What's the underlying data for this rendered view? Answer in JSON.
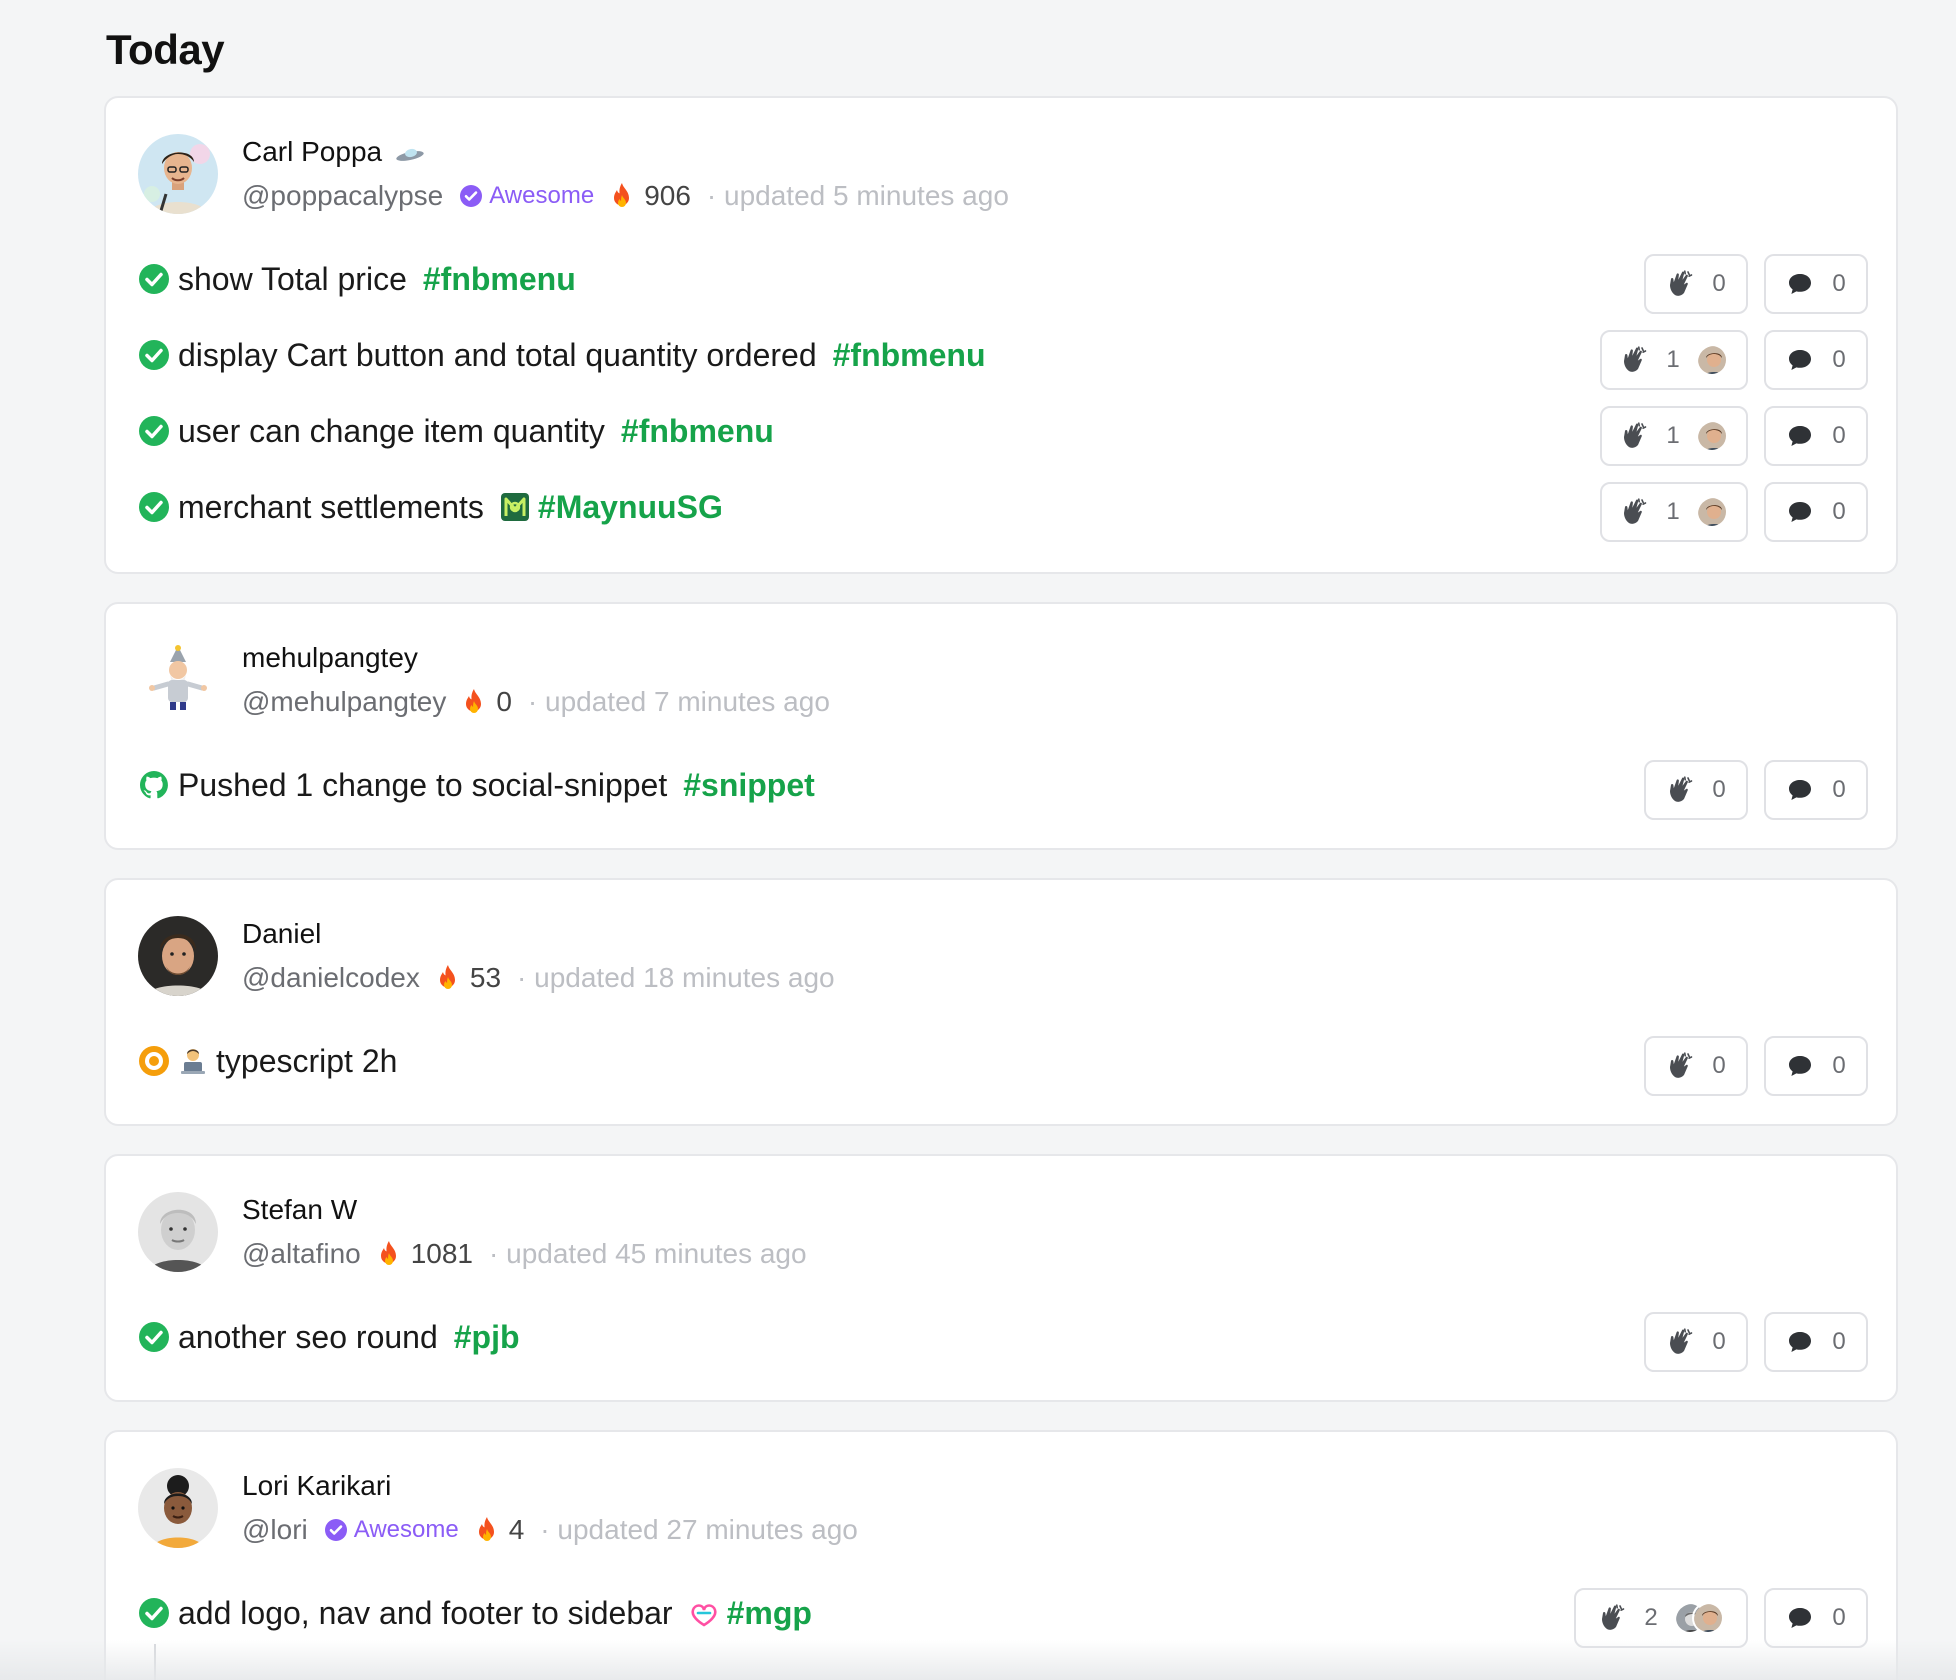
{
  "section_title": "Today",
  "posts": [
    {
      "name": "Carl Poppa",
      "name_emoji": "flying-saucer",
      "handle": "@poppacalypse",
      "badge": "Awesome",
      "streak": "906",
      "updated": "· updated 5 minutes ago",
      "tasks": [
        {
          "text": "show Total price",
          "tag": "#fnbmenu",
          "claps": "0",
          "comments": "0"
        },
        {
          "text": "display Cart button and total quantity ordered",
          "tag": "#fnbmenu",
          "claps": "1",
          "comments": "0"
        },
        {
          "text": "user can change item quantity",
          "tag": "#fnbmenu",
          "claps": "1",
          "comments": "0"
        },
        {
          "text": "merchant settlements",
          "tag": "#MaynuuSG",
          "claps": "1",
          "comments": "0"
        }
      ]
    },
    {
      "name": "mehulpangtey",
      "handle": "@mehulpangtey",
      "streak": "0",
      "updated": "· updated 7 minutes ago",
      "tasks": [
        {
          "text": "Pushed 1 change to social-snippet",
          "tag": "#snippet",
          "claps": "0",
          "comments": "0"
        }
      ]
    },
    {
      "name": "Daniel",
      "handle": "@danielcodex",
      "streak": "53",
      "updated": "· updated 18 minutes ago",
      "tasks": [
        {
          "text": "typescript 2h",
          "claps": "0",
          "comments": "0"
        }
      ]
    },
    {
      "name": "Stefan W",
      "handle": "@altafino",
      "streak": "1081",
      "updated": "· updated 45 minutes ago",
      "tasks": [
        {
          "text": "another seo round",
          "tag": "#pjb",
          "claps": "0",
          "comments": "0"
        }
      ]
    },
    {
      "name": "Lori Karikari",
      "handle": "@lori",
      "badge": "Awesome",
      "streak": "4",
      "updated": "· updated 27 minutes ago",
      "tasks": [
        {
          "text": "add logo, nav and footer to sidebar",
          "tag": "#mgp",
          "claps": "2",
          "comments": "0"
        }
      ]
    }
  ],
  "colors": {
    "done": "#22b45a",
    "tag": "#16a34a",
    "badge": "#8b5cf6",
    "in_progress": "#f59e0b"
  }
}
